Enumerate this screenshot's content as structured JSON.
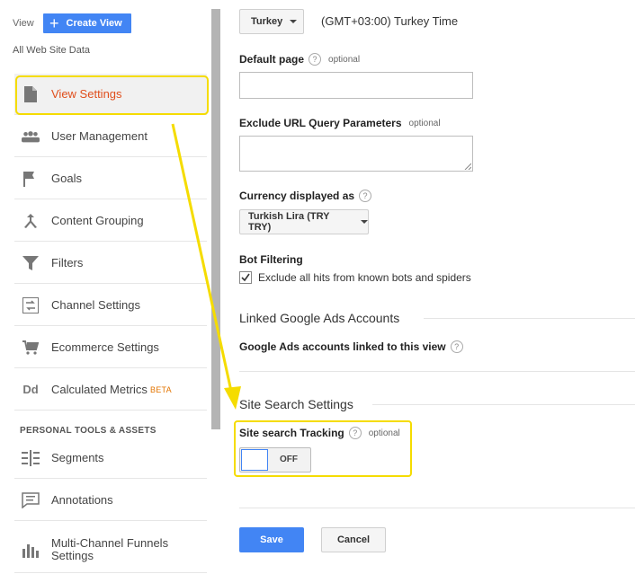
{
  "sidebar": {
    "view_label": "View",
    "create_view_label": "Create View",
    "all_data_label": "All Web Site Data",
    "items": [
      {
        "label": "View Settings",
        "icon": "document-icon"
      },
      {
        "label": "User Management",
        "icon": "people-icon"
      },
      {
        "label": "Goals",
        "icon": "flag-icon"
      },
      {
        "label": "Content Grouping",
        "icon": "merge-icon"
      },
      {
        "label": "Filters",
        "icon": "filter-icon"
      },
      {
        "label": "Channel Settings",
        "icon": "channel-settings-icon"
      },
      {
        "label": "Ecommerce Settings",
        "icon": "cart-icon"
      },
      {
        "label": "Calculated Metrics",
        "icon": "dd-icon",
        "badge": "BETA"
      }
    ],
    "section_header": "PERSONAL TOOLS & ASSETS",
    "personal_items": [
      {
        "label": "Segments",
        "icon": "segments-icon"
      },
      {
        "label": "Annotations",
        "icon": "annotations-icon"
      },
      {
        "label": "Multi-Channel Funnels Settings",
        "icon": "bar-chart-icon"
      }
    ]
  },
  "settings": {
    "country_value": "Turkey",
    "timezone_text": "(GMT+03:00) Turkey Time",
    "default_page_label": "Default page",
    "optional_label": "optional",
    "exclude_params_label": "Exclude URL Query Parameters",
    "currency_label": "Currency displayed as",
    "currency_value": "Turkish Lira (TRY TRY)",
    "bot_filtering_label": "Bot Filtering",
    "bot_checkbox_label": "Exclude all hits from known bots and spiders",
    "bot_checked": true,
    "linked_ads_title": "Linked Google Ads Accounts",
    "linked_ads_label": "Google Ads accounts linked to this view",
    "site_search_title": "Site Search Settings",
    "site_search_tracking_label": "Site search Tracking",
    "toggle_state": "OFF",
    "save_label": "Save",
    "cancel_label": "Cancel",
    "help_glyph": "?"
  },
  "colors": {
    "accent": "#4285f4",
    "active_text": "#e04e1c",
    "highlight": "#f5dc00",
    "beta": "#e37400"
  }
}
